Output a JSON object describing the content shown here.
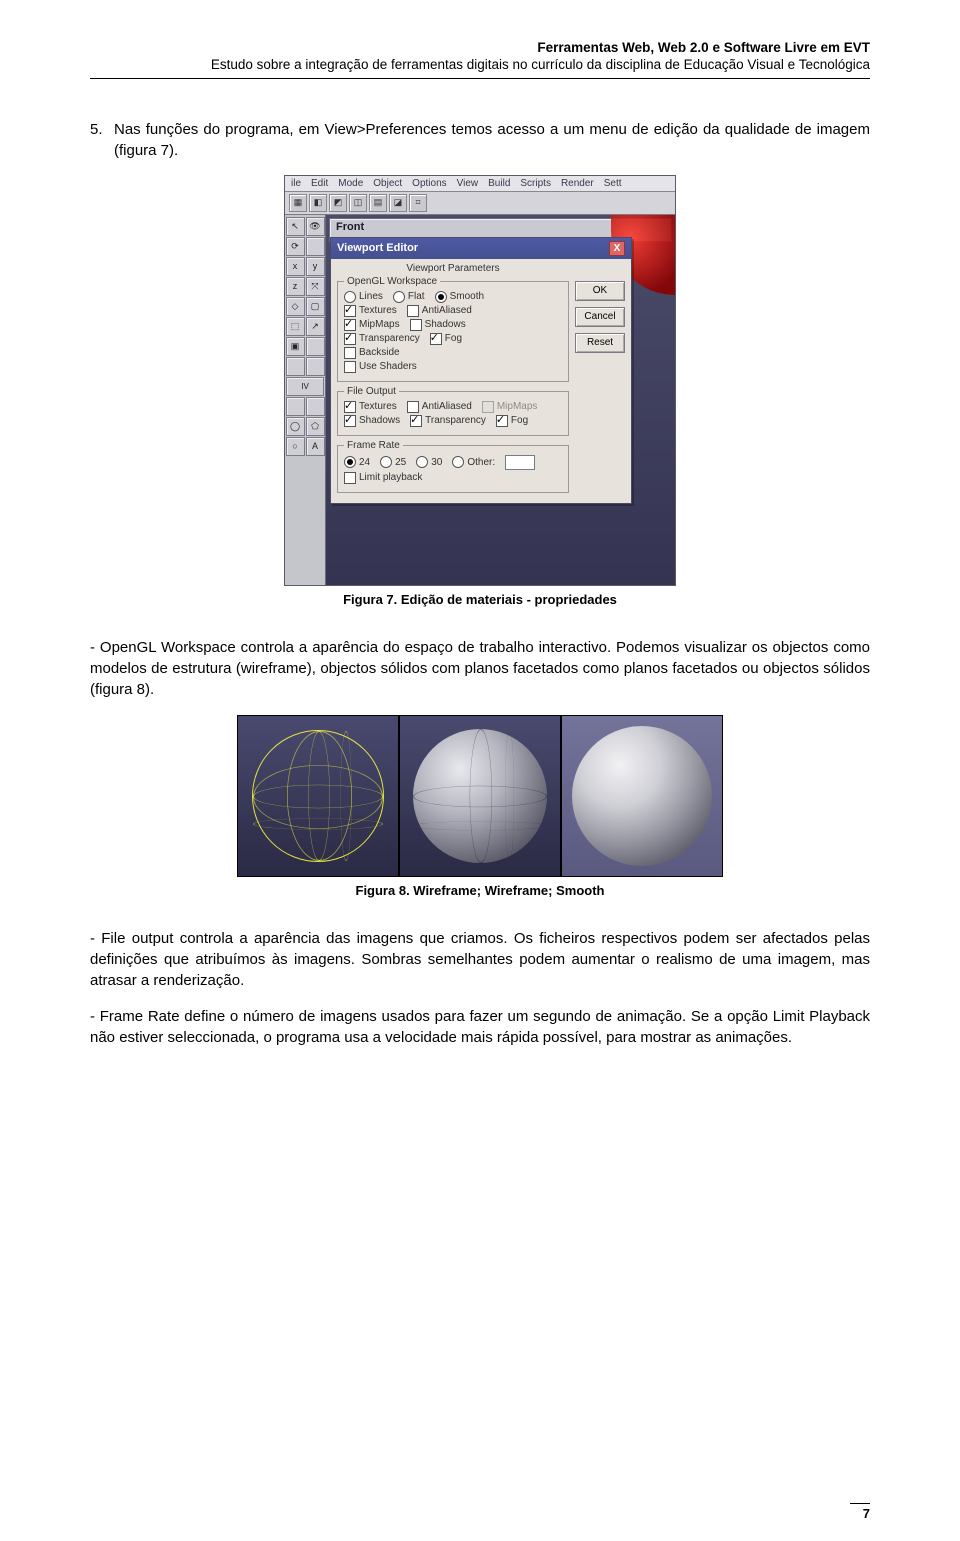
{
  "header": {
    "line1": "Ferramentas Web, Web 2.0 e Software Livre em EVT",
    "line2": "Estudo sobre a integração de ferramentas digitais no currículo da disciplina de Educação Visual e Tecnológica"
  },
  "intro": {
    "num": "5.",
    "text": "Nas funções do programa, em View>Preferences temos acesso a um menu de edição da qualidade de imagem (figura 7)."
  },
  "fig7": {
    "menubar": [
      "ile",
      "Edit",
      "Mode",
      "Object",
      "Options",
      "View",
      "Build",
      "Scripts",
      "Render",
      "Sett"
    ],
    "front": "Front",
    "dialog": {
      "title": "Viewport Editor",
      "close": "X",
      "params_label": "Viewport Parameters",
      "btn_ok": "OK",
      "btn_cancel": "Cancel",
      "btn_reset": "Reset",
      "group_ogl": {
        "legend": "OpenGL Workspace",
        "radio_lines": "Lines",
        "radio_flat": "Flat",
        "radio_smooth": "Smooth",
        "chk_textures": "Textures",
        "chk_antialiased": "AntiAliased",
        "chk_mipmaps": "MipMaps",
        "chk_shadows": "Shadows",
        "chk_transparency": "Transparency",
        "chk_fog": "Fog",
        "chk_backside": "Backside",
        "chk_useshaders": "Use Shaders"
      },
      "group_file": {
        "legend": "File Output",
        "chk_textures": "Textures",
        "chk_antialiased": "AntiAliased",
        "chk_mipmaps": "MipMaps",
        "chk_shadows": "Shadows",
        "chk_transparency": "Transparency",
        "chk_fog": "Fog"
      },
      "group_rate": {
        "legend": "Frame Rate",
        "r24": "24",
        "r25": "25",
        "r30": "30",
        "rother": "Other:",
        "chk_limit": "Limit playback"
      }
    },
    "left_labels": {
      "iv": "IV",
      "a": "A"
    },
    "caption": "Figura 7. Edição de materiais - propriedades"
  },
  "para1": "- OpenGL Workspace controla a aparência do espaço de trabalho interactivo. Podemos visualizar os objectos como modelos de estrutura (wireframe), objectos sólidos com planos facetados como planos facetados ou objectos sólidos (figura 8).",
  "fig8": {
    "caption": "Figura 8. Wireframe; Wireframe; Smooth"
  },
  "para2": "- File output controla a aparência das imagens que criamos. Os ficheiros respectivos podem ser afectados pelas definições que atribuímos às imagens. Sombras semelhantes podem aumentar o realismo de uma imagem, mas atrasar a renderização.",
  "para3": "- Frame Rate define o número de imagens usados para fazer um segundo de animação. Se a opção Limit Playback não estiver seleccionada, o programa usa a velocidade mais rápida possível, para mostrar as animações.",
  "page_number": "7"
}
